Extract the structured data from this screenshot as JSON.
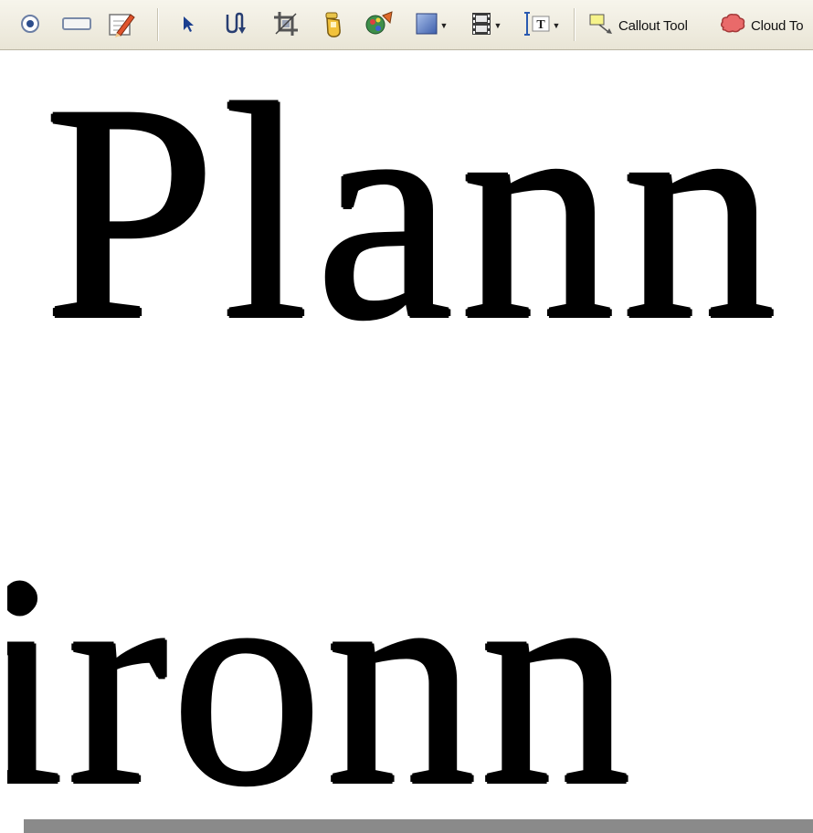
{
  "toolbar": {
    "callout_tool_label": "Callout Tool",
    "cloud_tool_label": "Cloud To"
  },
  "canvas": {
    "line1_text": "Plann",
    "line2_text": "ironn"
  },
  "colors": {
    "toolbar_bg": "#ece9d8",
    "canvas_bg": "#ffffff",
    "text": "#000000",
    "shadow": "#8a8a8a"
  },
  "icons": [
    "radio-tool-icon",
    "rectangle-tool-icon",
    "pencil-tool-icon",
    "pointer-tool-icon",
    "path-tool-icon",
    "crop-tool-icon",
    "hand-tool-icon",
    "color-tool-icon",
    "fill-color-icon",
    "film-tool-icon",
    "text-frame-tool-icon",
    "callout-tool-icon",
    "cloud-tool-icon"
  ]
}
